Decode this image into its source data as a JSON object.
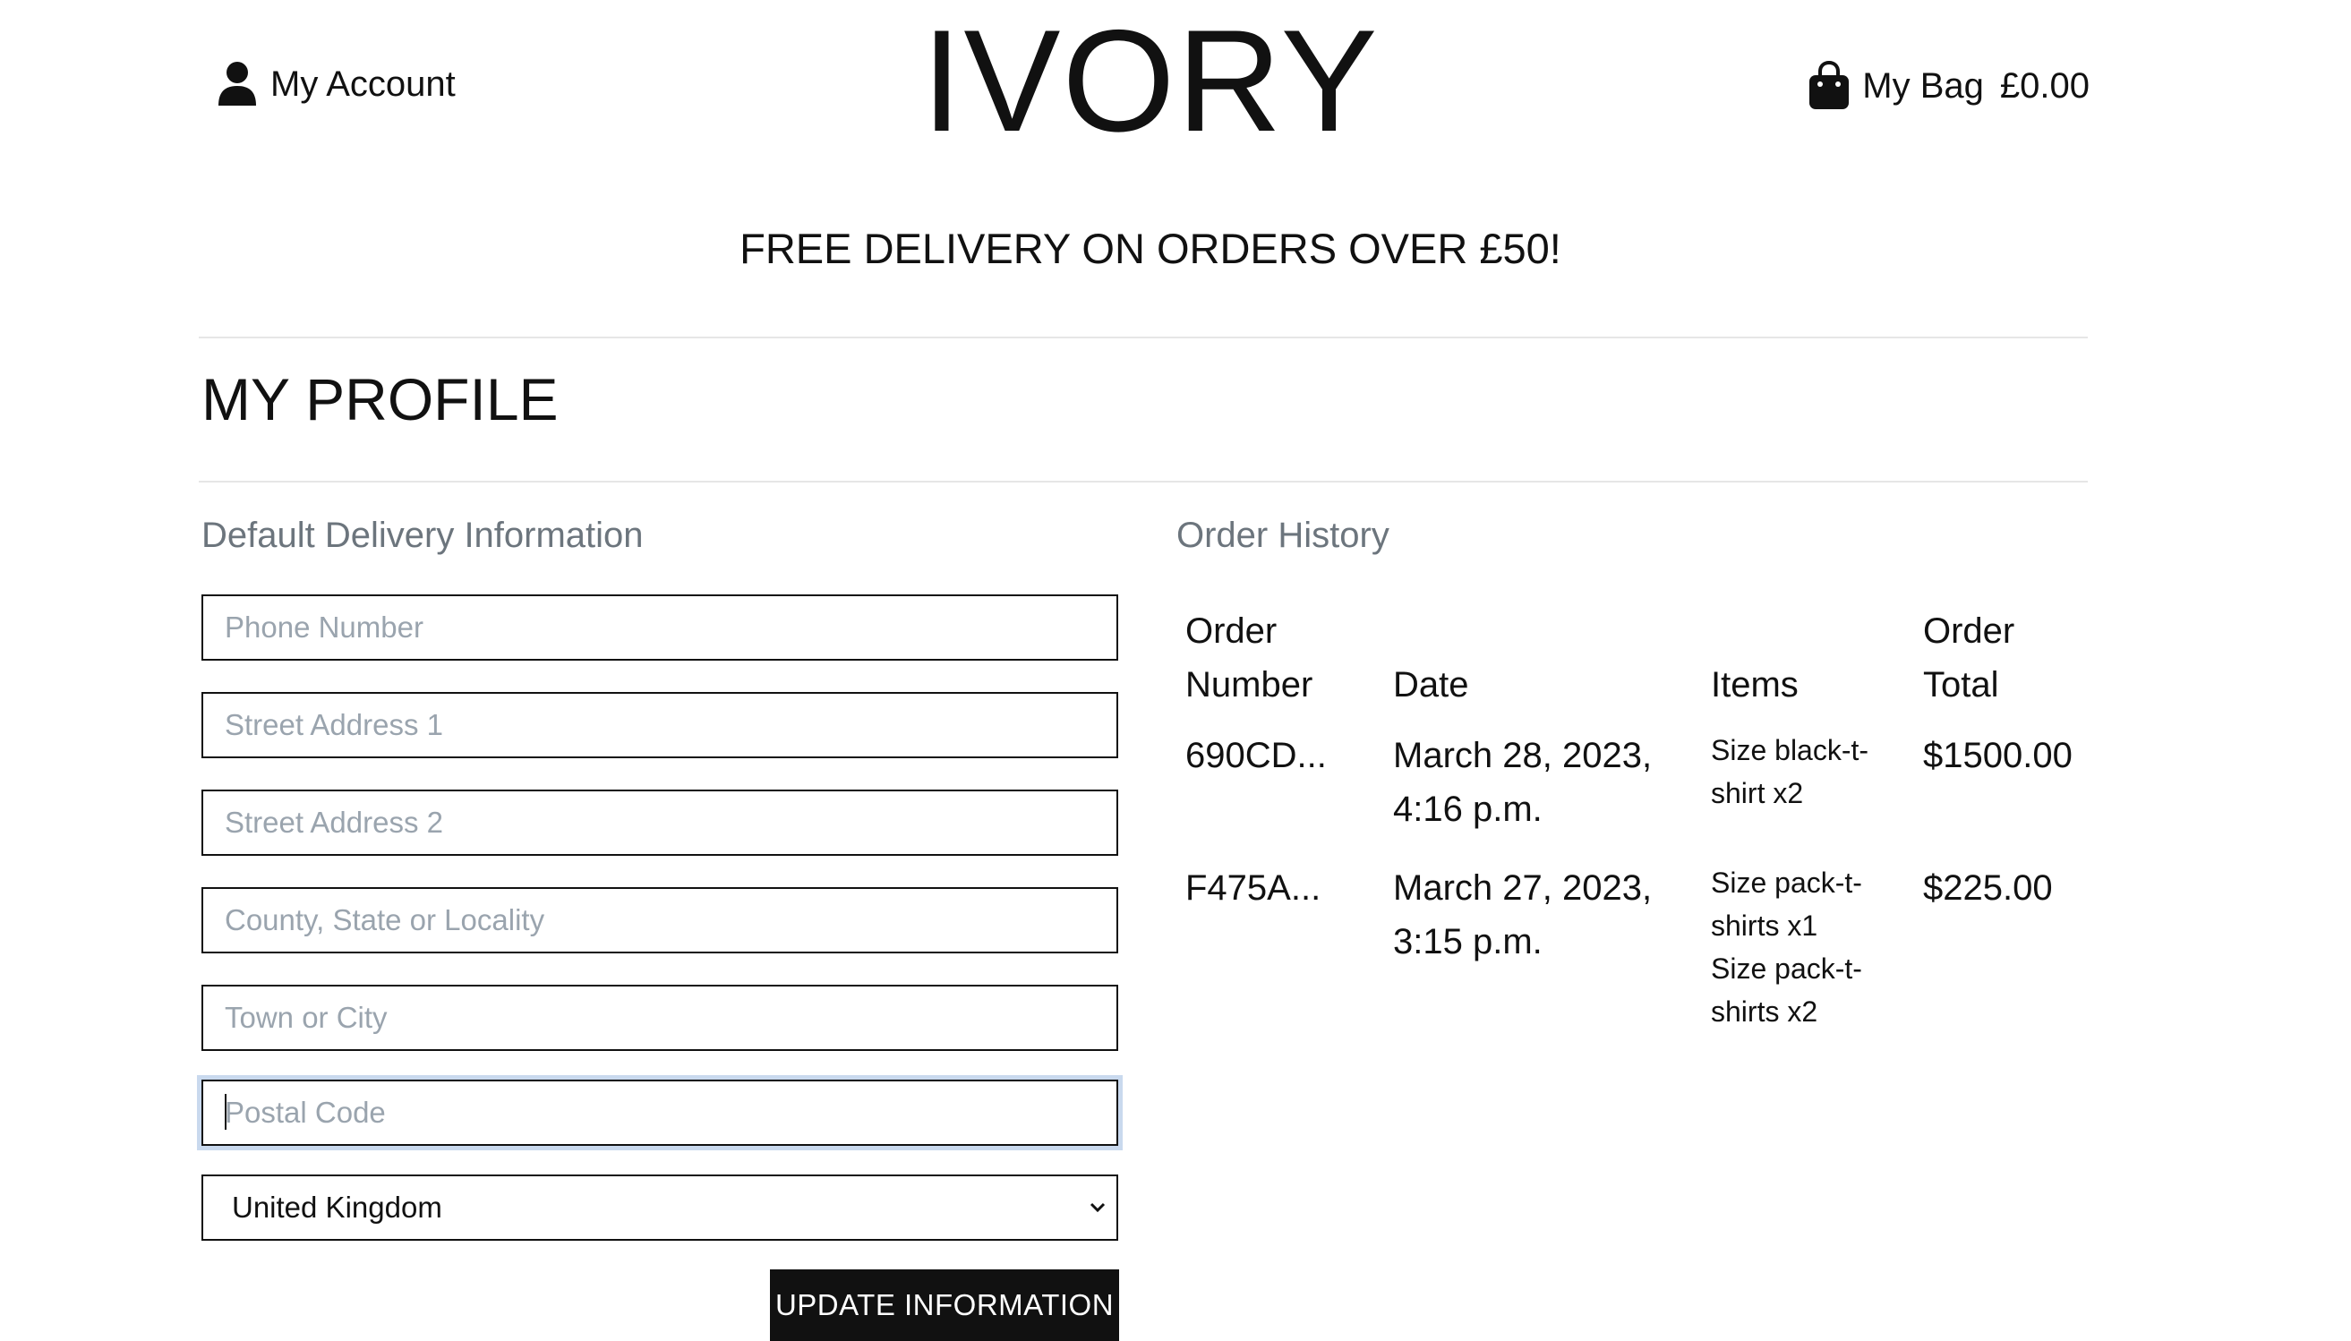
{
  "header": {
    "account_label": "My Account",
    "logo": "IVORY",
    "bag_label": "My Bag",
    "bag_total": "£0.00"
  },
  "promo": "FREE DELIVERY ON ORDERS OVER £50!",
  "page_title": "MY PROFILE",
  "delivery": {
    "title": "Default Delivery Information",
    "fields": [
      {
        "placeholder": "Phone Number",
        "value": ""
      },
      {
        "placeholder": "Street Address 1",
        "value": ""
      },
      {
        "placeholder": "Street Address 2",
        "value": ""
      },
      {
        "placeholder": "County, State or Locality",
        "value": ""
      },
      {
        "placeholder": "Town or City",
        "value": ""
      },
      {
        "placeholder": "Postal Code",
        "value": ""
      }
    ],
    "country": "United Kingdom",
    "submit_label": "UPDATE INFORMATION"
  },
  "orders": {
    "title": "Order History",
    "columns": {
      "number_line1": "Order",
      "number_line2": "Number",
      "date": "Date",
      "items": "Items",
      "total_line1": "Order",
      "total_line2": "Total"
    },
    "rows": [
      {
        "number": "690CD...",
        "date_line1": "March 28, 2023,",
        "date_line2": "4:16 p.m.",
        "items": [
          {
            "line1": "Size black-t-",
            "line2": "shirt x2"
          }
        ],
        "total": "$1500.00"
      },
      {
        "number": "F475A...",
        "date_line1": "March 27, 2023,",
        "date_line2": "3:15 p.m.",
        "items": [
          {
            "line1": "Size pack-t-",
            "line2": "shirts x1"
          },
          {
            "line1": "Size pack-t-",
            "line2": "shirts x2"
          }
        ],
        "total": "$225.00"
      }
    ]
  },
  "icons": {
    "account": "user-icon",
    "bag": "shopping-bag-icon",
    "select": "chevron-down-icon"
  }
}
